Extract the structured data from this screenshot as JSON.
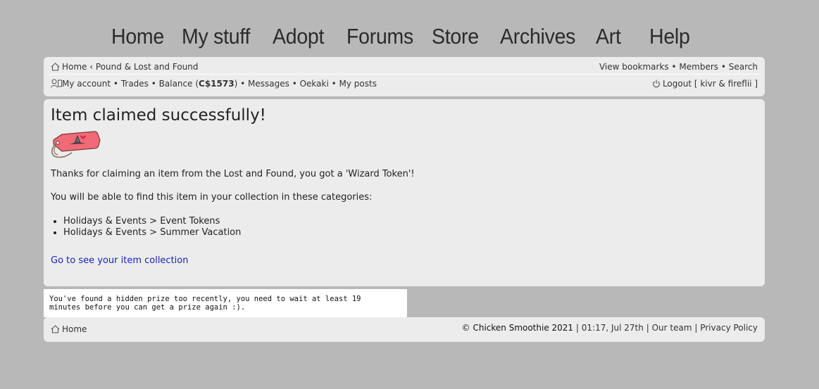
{
  "topnav": [
    "Home",
    "My stuff",
    "Adopt",
    "Forums",
    "Store",
    "Archives",
    "Art",
    "Help"
  ],
  "header": {
    "breadcrumb_home": "Home",
    "breadcrumb_sep": "‹",
    "breadcrumb_current": "Pound & Lost and Found",
    "view_bookmarks": "View bookmarks",
    "members": "Members",
    "search": "Search",
    "bullet": "•",
    "my_account": "My account",
    "trades": "Trades",
    "balance_label": "Balance (",
    "balance_value": "C$1573",
    "balance_close": ")",
    "messages": "Messages",
    "oekaki": "Oekaki",
    "my_posts": "My posts",
    "logout": "Logout",
    "logout_user": "[ kivr & fireflii ]"
  },
  "main": {
    "title": "Item claimed successfully!",
    "message": "Thanks for claiming an item from the Lost and Found, you got a 'Wizard Token'!",
    "categories_intro": "You will be able to find this item in your collection in these categories:",
    "categories": [
      "Holidays & Events > Event Tokens",
      "Holidays & Events > Summer Vacation"
    ],
    "collection_link": "Go to see your item collection"
  },
  "notice": "You've found a hidden prize too recently, you need to wait at least 19 minutes before you can get a prize again :).",
  "footer": {
    "home": "Home",
    "copyright": "© Chicken Smoothie 2021",
    "pipe": "|",
    "datetime": "01:17, Jul 27th",
    "our_team": "Our team",
    "privacy": "Privacy Policy"
  },
  "colors": {
    "background": "#b8b8b8",
    "panel": "#ececec",
    "link": "#1a23b8"
  }
}
